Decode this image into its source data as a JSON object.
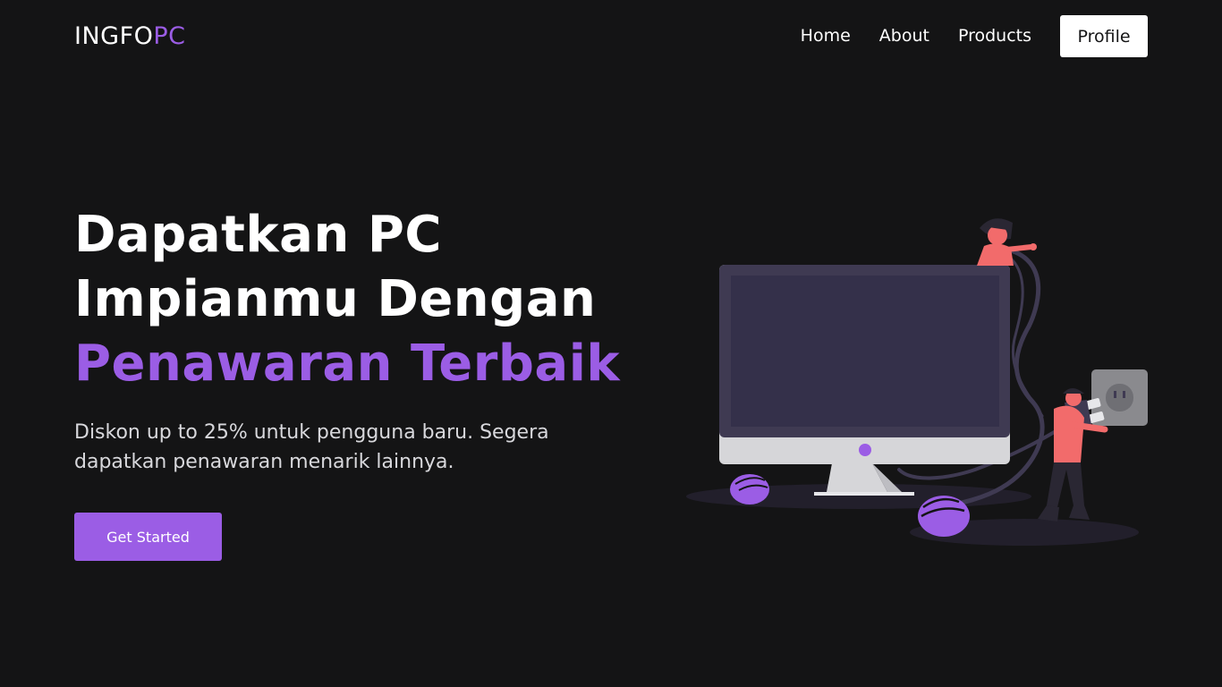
{
  "brand": {
    "part1": "INGFO",
    "part2": "PC"
  },
  "nav": {
    "home": "Home",
    "about": "About",
    "products": "Products",
    "profile": "Profile"
  },
  "hero": {
    "line1": "Dapatkan PC",
    "line2": "Impianmu Dengan",
    "line3": "Penawaran Terbaik",
    "description": "Diskon up to 25% untuk pengguna baru. Segera dapatkan penawaran menarik lainnya.",
    "cta": "Get Started"
  },
  "colors": {
    "background": "#141415",
    "accent": "#9b5de5",
    "text": "#ffffff",
    "person": "#f26b6b",
    "monitor_screen": "#34304a",
    "monitor_bezel": "#d6d6d9"
  },
  "icons": {
    "illustration": "person-plugging-pc-illustration"
  }
}
